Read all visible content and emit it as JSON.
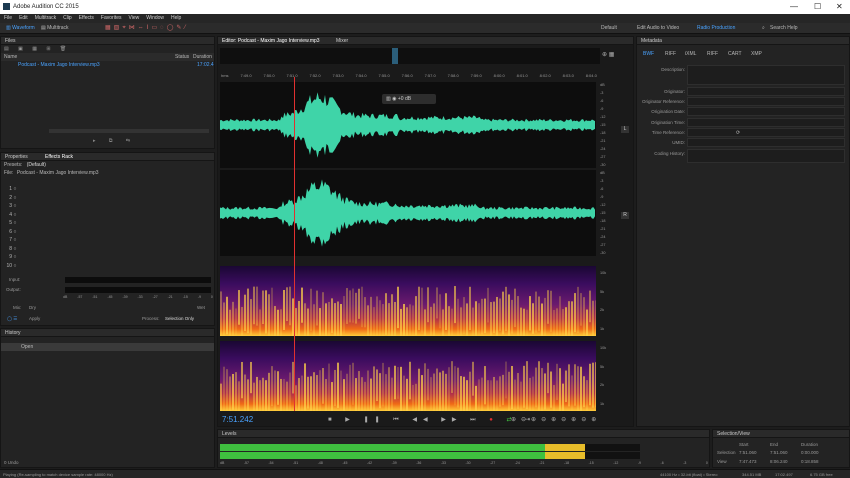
{
  "window": {
    "title": "Adobe Audition CC 2015",
    "min": "—",
    "max": "☐",
    "close": "✕"
  },
  "menu": [
    "File",
    "Edit",
    "Multitrack",
    "Clip",
    "Effects",
    "Favorites",
    "View",
    "Window",
    "Help"
  ],
  "toolbar": {
    "waveform": "Waveform",
    "multitrack": "Multitrack",
    "workspace_default": "Default",
    "workspace_edit": "Edit Audio to Video",
    "workspace_radio": "Radio Production",
    "search_placeholder": "Search Help"
  },
  "files": {
    "title": "Files",
    "col_name": "Name",
    "col_status": "Status",
    "col_duration": "Duration",
    "items": [
      {
        "name": "Podcast - Maxim Jago Interview.mp3",
        "duration": "17:02.4"
      }
    ]
  },
  "effects": {
    "tab_properties": "Properties",
    "tab_rack": "Effects Rack",
    "presets_label": "Presets:",
    "presets_value": "(Default)",
    "file_label": "File:",
    "file_value": "Podcast - Maxim Jago Interview.mp3",
    "slots": [
      "1",
      "2",
      "3",
      "4",
      "5",
      "6",
      "7",
      "8",
      "9",
      "10"
    ],
    "input": "Input:",
    "output": "Output:",
    "mix": "Mix:",
    "dry": "Dry",
    "wet": "Wet",
    "apply": "Apply",
    "process": "Process:",
    "process_value": "Selection Only",
    "meter_ticks": [
      "dB",
      "-57",
      "-54",
      "-51",
      "-48",
      "-45",
      "-42",
      "-39",
      "-36",
      "-33",
      "-30",
      "-27",
      "-24",
      "-21",
      "-18",
      "-15",
      "-12",
      "-9",
      "-6",
      "-3",
      "0"
    ]
  },
  "history": {
    "title": "History",
    "open": "Open",
    "undos": "0 Undo"
  },
  "editor": {
    "tab": "Editor: Podcast - Maxim Jago Interview.mp3",
    "mixer": "Mixer",
    "time_labels": [
      "hms",
      "7:49.0",
      "7:50.0",
      "7:51.0",
      "7:52.0",
      "7:53.0",
      "7:54.0",
      "7:55.0",
      "7:56.0",
      "7:57.0",
      "7:58.0",
      "7:59.0",
      "8:00.0",
      "8:01.0",
      "8:02.0",
      "8:03.0",
      "8:04.0",
      "8:05.0"
    ],
    "hud_value": "+0 dB",
    "db_scale_top": [
      "dB",
      "-3",
      "-6",
      "-9",
      "-12",
      "-15",
      "-18",
      "-21",
      "-24",
      "-27",
      "-30"
    ],
    "db_scale_bottom": [
      "dB",
      "-3",
      "-6",
      "-9",
      "-12",
      "-15",
      "-18",
      "-21",
      "-24",
      "-27",
      "-30"
    ],
    "spec_scale": [
      "10k",
      "5k",
      "2k",
      "1k"
    ],
    "channel_top": "L",
    "channel_bottom": "R",
    "current_time": "7:51.242"
  },
  "levels": {
    "title": "Levels",
    "ticks": [
      "dB",
      "-57",
      "-54",
      "-51",
      "-48",
      "-45",
      "-42",
      "-39",
      "-36",
      "-33",
      "-30",
      "-27",
      "-24",
      "-21",
      "-18",
      "-15",
      "-12",
      "-9",
      "-6",
      "-3",
      "0"
    ],
    "left_level": 0.87,
    "right_level": 0.87
  },
  "selection_view": {
    "title": "Selection/View",
    "col_start": "Start",
    "col_end": "End",
    "col_duration": "Duration",
    "selection_label": "Selection",
    "view_label": "View",
    "selection": [
      "7:51.060",
      "7:51.060",
      "0:00.000"
    ],
    "view": [
      "7:47.473",
      "8:06.240",
      "0:18.858"
    ]
  },
  "metadata": {
    "title": "Metadata",
    "tabs": [
      "BWF",
      "RIFF",
      "iXML",
      "RIFF",
      "CART",
      "XMP"
    ],
    "fields": [
      "Description:",
      "Originator:",
      "Originator Reference:",
      "Origination Date:",
      "Origination Time:",
      "Time Reference:",
      "UMID:",
      "Coding History:"
    ]
  },
  "status": {
    "left": "Playing (Re-sampling to match device sample rate: 48000 Hz)",
    "sample": "44100 Hz • 32-bit (float) • Stereo",
    "size1": "344.51 MB",
    "duration": "17:02.497",
    "free": "6.75 GB free"
  },
  "colors": {
    "accent": "#4aa3ff",
    "wave": "#3fd4a8",
    "playhead": "#e03030",
    "level_green": "#3fbf3f",
    "level_yellow": "#e8bd2a"
  }
}
